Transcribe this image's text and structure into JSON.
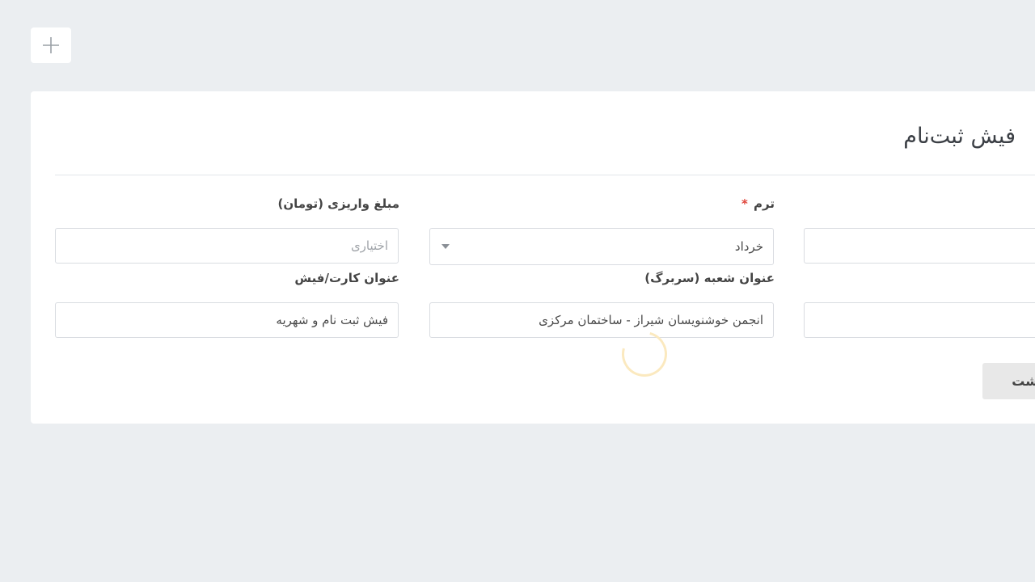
{
  "toolbar": {
    "add_icon": "plus-icon"
  },
  "form": {
    "title": "فیش ثبت‌نام",
    "term": {
      "label": "ترم",
      "required_mark": "*",
      "value": "خرداد"
    },
    "amount": {
      "label": "مبلغ واریزی (تومان)",
      "placeholder": "اختیاری"
    },
    "branch_title": {
      "label": "عنوان شعبه (سربرگ)",
      "value": "انجمن خوشنویسان شیراز - ساختمان مرکزی"
    },
    "card_title": {
      "label": "عنوان کارت/فیش",
      "value": "فیش ثبت نام و شهریه"
    },
    "back_button": "بازگشت"
  },
  "colors": {
    "background": "#ebeef1",
    "card": "#ffffff",
    "required": "#e0453b",
    "spinner": "#fbe9bf"
  }
}
